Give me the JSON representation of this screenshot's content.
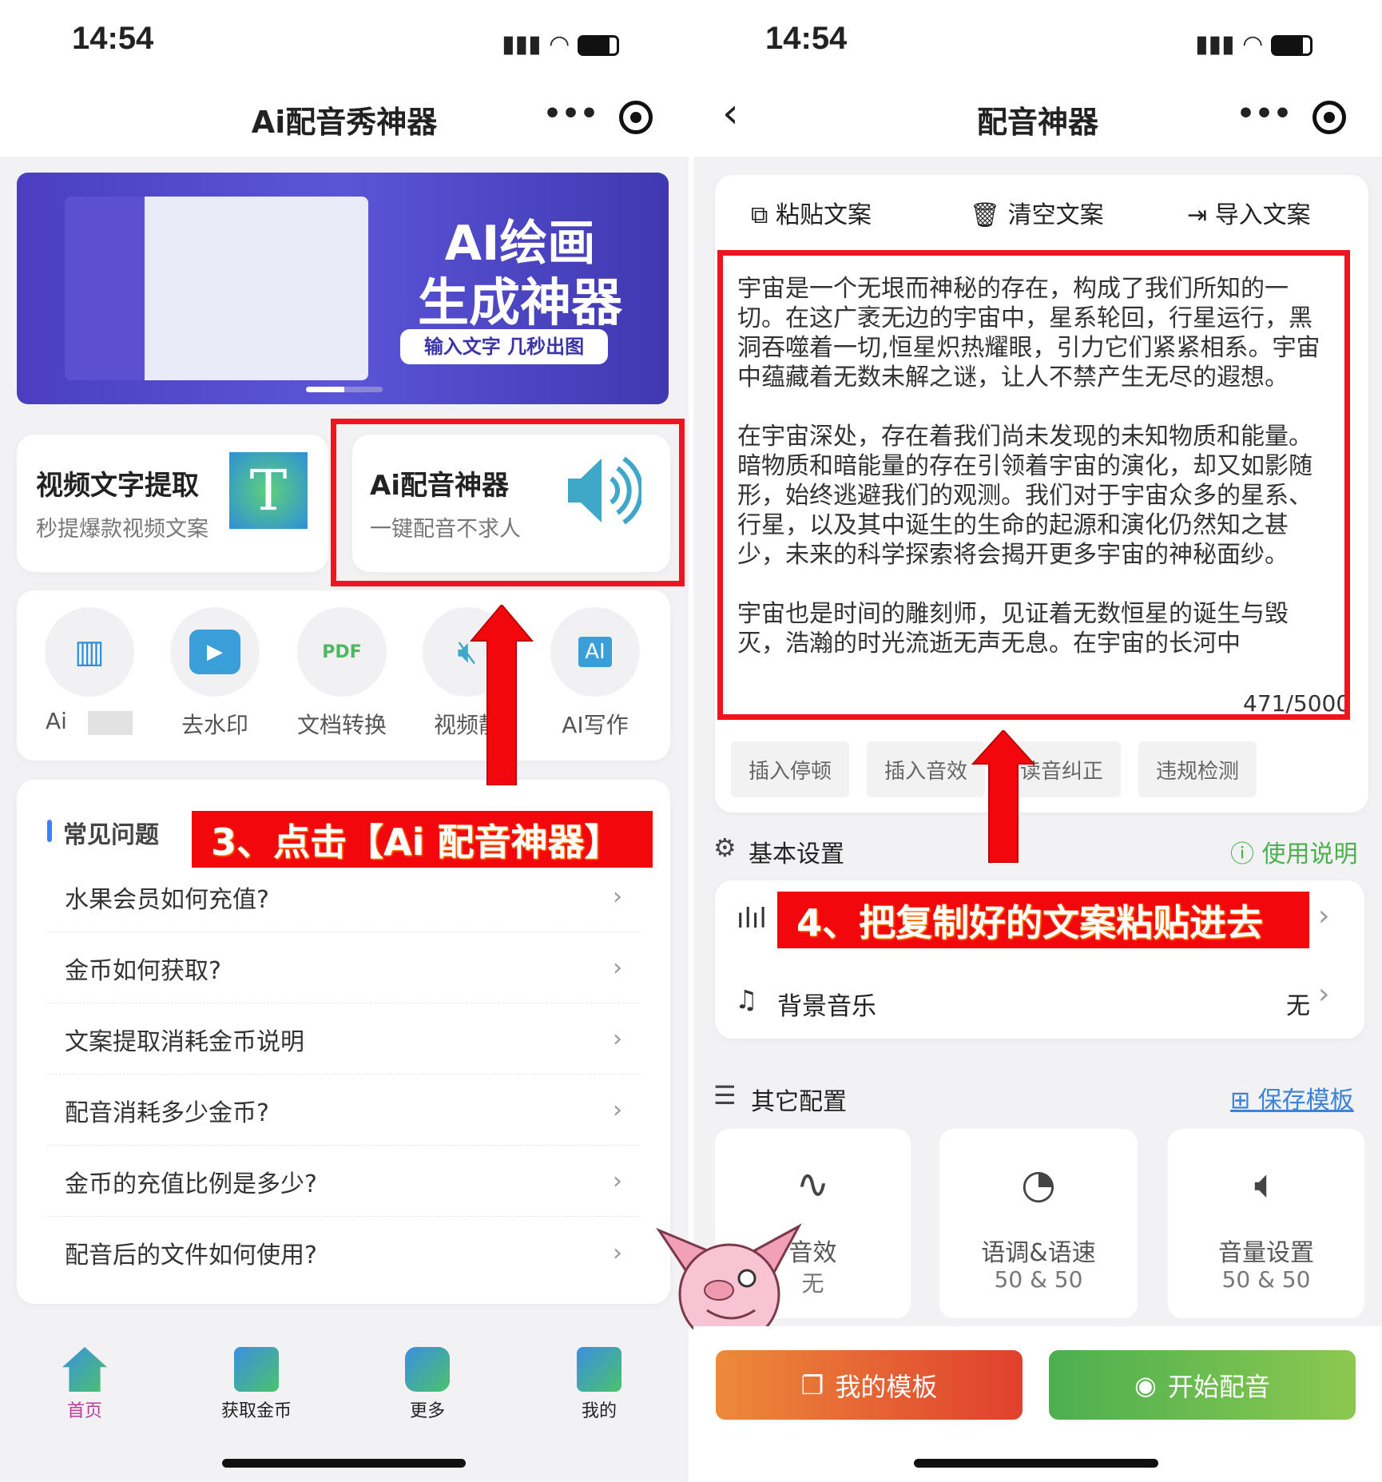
{
  "left": {
    "status_time": "14:54",
    "title": "Ai配音秀神器",
    "banner": {
      "line1": "AI绘画",
      "line2": "生成神器",
      "tag": "输入文字 几秒出图"
    },
    "feature_cards": [
      {
        "title": "视频文字提取",
        "subtitle": "秒提爆款视频文案",
        "icon": "text-t-icon"
      },
      {
        "title": "Ai配音神器",
        "subtitle": "一键配音不求人",
        "icon": "speaker-icon"
      }
    ],
    "tools": [
      {
        "label": "Ai",
        "icon": "barcode-search-icon"
      },
      {
        "label": "去水印",
        "icon": "video-play-icon"
      },
      {
        "label": "文档转换",
        "icon": "pdf-icon"
      },
      {
        "label": "视频静",
        "icon": "mute-icon"
      },
      {
        "label": "AI写作",
        "icon": "ai-doc-icon"
      }
    ],
    "faq_title": "常见问题",
    "faq": [
      "水果会员如何充值?",
      "金币如何获取?",
      "文案提取消耗金币说明",
      "配音消耗多少金币?",
      "金币的充值比例是多少?",
      "配音后的文件如何使用?"
    ],
    "annotation": "3、点击【Ai 配音神器】",
    "tabs": [
      {
        "label": "首页",
        "icon": "home-icon",
        "active": true
      },
      {
        "label": "获取金币",
        "icon": "link-icon"
      },
      {
        "label": "更多",
        "icon": "grid-icon"
      },
      {
        "label": "我的",
        "icon": "user-icon"
      }
    ],
    "active_tab_color": "#c0399a"
  },
  "right": {
    "status_time": "14:54",
    "title": "配音神器",
    "toolbar": [
      "粘贴文案",
      "清空文案",
      "导入文案"
    ],
    "text": "宇宙是一个无垠而神秘的存在，构成了我们所知的一切。在这广袤无边的宇宙中，星系轮回，行星运行，黑洞吞噬着一切,恒星炽热耀眼，引力它们紧紧相系。宇宙中蕴藏着无数未解之谜，让人不禁产生无尽的遐想。\n\n在宇宙深处，存在着我们尚未发现的未知物质和能量。暗物质和暗能量的存在引领着宇宙的演化，却又如影随形，始终逃避我们的观测。我们对于宇宙众多的星系、行星，以及其中诞生的生命的起源和演化仍然知之甚少，未来的科学探索将会揭开更多宇宙的神秘面纱。\n\n宇宙也是时间的雕刻师，见证着无数恒星的诞生与毁灭，浩瀚的时光流逝无声无息。在宇宙的长河中",
    "counter": "471/5000",
    "chips": [
      "插入停顿",
      "插入音效",
      "读音纠正",
      "违规检测"
    ],
    "basic_settings": "基本设置",
    "help_link": "使用说明",
    "bg_music_label": "背景音乐",
    "bg_music_value": "无",
    "annotation": "4、把复制好的文案粘贴进去",
    "other_config": "其它配置",
    "save_template": "保存模板",
    "options": [
      {
        "label": "音效",
        "value": "无",
        "icon": "pulse-icon"
      },
      {
        "label": "语调&语速",
        "value": "50 & 50",
        "icon": "speedometer-icon"
      },
      {
        "label": "音量设置",
        "value": "50 & 50",
        "icon": "volume-icon"
      }
    ],
    "my_template": "我的模板",
    "start_dubbing": "开始配音",
    "colors": {
      "green": "#4caf50",
      "blue": "#3b82d8",
      "annotation_red": "#f2070d"
    }
  }
}
